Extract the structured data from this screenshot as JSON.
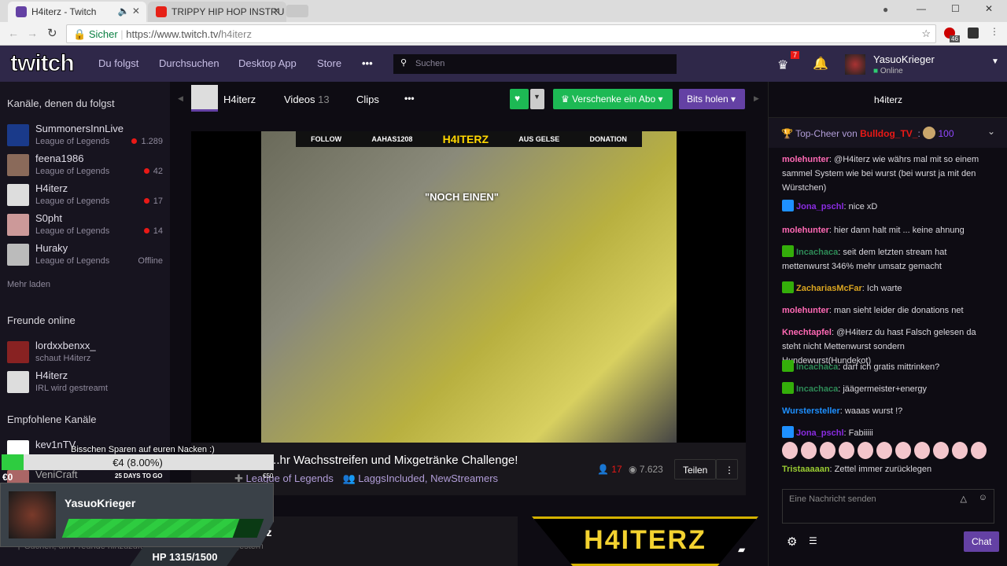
{
  "browser": {
    "tabs": [
      {
        "title": "H4iterz - Twitch"
      },
      {
        "title": "TRIPPY HIP HOP INSTRU"
      }
    ],
    "secure_label": "Sicher",
    "url_host": "https://www.twitch.tv/",
    "url_path": "h4iterz",
    "ext_badge": "46"
  },
  "nav": {
    "logo": "twitch",
    "links": [
      "Du folgst",
      "Durchsuchen",
      "Desktop App",
      "Store"
    ],
    "more": "•••",
    "search_placeholder": "Suchen",
    "crown_badge": "7",
    "user": "YasuoKrieger",
    "status": "Online"
  },
  "sidebar": {
    "followed_heading": "Kanäle, denen du folgst",
    "followed": [
      {
        "name": "SummonersInnLive",
        "game": "League of Legends",
        "viewers": "1.289"
      },
      {
        "name": "feena1986",
        "game": "League of Legends",
        "viewers": "42"
      },
      {
        "name": "H4iterz",
        "game": "League of Legends",
        "viewers": "17"
      },
      {
        "name": "S0pht",
        "game": "League of Legends",
        "viewers": "14"
      },
      {
        "name": "Huraky",
        "game": "League of Legends",
        "viewers": "Offline"
      }
    ],
    "more": "Mehr laden",
    "friends_heading": "Freunde online",
    "friends": [
      {
        "name": "lordxxbenxx_",
        "status": "schaut H4iterz"
      },
      {
        "name": "H4iterz",
        "status": "IRL wird gestreamt"
      }
    ],
    "recommended_heading": "Empfohlene Kanäle",
    "recommended": [
      {
        "name": "kev1nTV"
      },
      {
        "name": "VeniCraft"
      }
    ],
    "friend_search": "Suchen, um Freunde hinzuzufügen"
  },
  "channel": {
    "name": "H4iterz",
    "videos_label": "Videos",
    "videos_count": "13",
    "clips_label": "Clips",
    "more": "•••",
    "gift_label": "Verschenke ein Abo",
    "bits_label": "Bits holen"
  },
  "stream": {
    "title": "...hr Wachsstreifen und Mixgetränke Challenge!",
    "game": "League of Legends",
    "teams": [
      "LaggsIncluded",
      "NewStreamers"
    ],
    "live_viewers": "17",
    "total_views": "7.623",
    "share": "Teilen",
    "overlay_caption": "\"NOCH EINEN\"",
    "overlay_name": "H4ITERZ",
    "overlay_left": "FOLLOW",
    "overlay_user": "AAHAS1208",
    "overlay_right": "AUS GELSE",
    "overlay_donation": "DONATION"
  },
  "lower": {
    "name_tail": "rz",
    "time": "gestern",
    "banner": "H4ITERZ"
  },
  "donation_goal": {
    "title": "Bisschen Sparen auf euren Nacken :)",
    "amount": "€4 (8.00%)",
    "progress": 0.08,
    "min": "€0",
    "max": "€50",
    "remaining": "25 DAYS TO GO"
  },
  "hp_widget": {
    "name": "YasuoKrieger",
    "hp_text": "HP 1315/1500",
    "hp": 1315,
    "hp_max": 1500
  },
  "chat": {
    "header": "h4iterz",
    "top_cheer_prefix": "Top-Cheer von",
    "top_cheer_user": "Bulldog_TV_",
    "top_cheer_sep": ":",
    "top_cheer_amount": "100",
    "messages": [
      {
        "user": "molehunter",
        "color": "#ff69b4",
        "badge": "",
        "text": "@H4iterz wie währs mal mit so einem sammel System wie bei wurst (bei wurst ja mit den Würstchen)"
      },
      {
        "user": "Jona_pschl",
        "color": "#8a2be2",
        "badge": "sub",
        "text": "nice xD"
      },
      {
        "user": "molehunter",
        "color": "#ff69b4",
        "badge": "",
        "text": "hier dann halt mit ... keine ahnung"
      },
      {
        "user": "Incachaca",
        "color": "#2e8b57",
        "badge": "mod",
        "text": "seit dem letzten stream hat mettenwurst 346% mehr umsatz gemacht"
      },
      {
        "user": "ZachariasMcFar",
        "color": "#daa520",
        "badge": "mod",
        "text": "Ich warte"
      },
      {
        "user": "molehunter",
        "color": "#ff69b4",
        "badge": "",
        "text": "man sieht leider die donations net"
      },
      {
        "user": "Knechtapfel",
        "color": "#ff69b4",
        "badge": "",
        "text": "@H4iterz du hast Falsch gelesen da steht nicht Mettenwurst sondern Hundewurst(Hundekot)"
      },
      {
        "user": "Incachaca",
        "color": "#2e8b57",
        "badge": "mod",
        "text": "darf ich gratis mittrinken?"
      },
      {
        "user": "Incachaca",
        "color": "#2e8b57",
        "badge": "mod",
        "text": "jäägermeister+energy"
      },
      {
        "user": "Wurstersteller",
        "color": "#1e90ff",
        "badge": "",
        "text": "waaas wurst !?"
      },
      {
        "user": "Jona_pschl",
        "color": "#8a2be2",
        "badge": "sub",
        "text": "Fabiiiii"
      },
      {
        "user": "Tristaaaaan",
        "color": "#9acd32",
        "badge": "",
        "text": "Zettel immer zurücklegen"
      }
    ],
    "input_placeholder": "Eine Nachricht senden",
    "send": "Chat"
  },
  "colors": {
    "twitch_purple": "#6441a4",
    "nav_bg": "#2f2849",
    "green": "#1db954",
    "live_red": "#e91916"
  }
}
